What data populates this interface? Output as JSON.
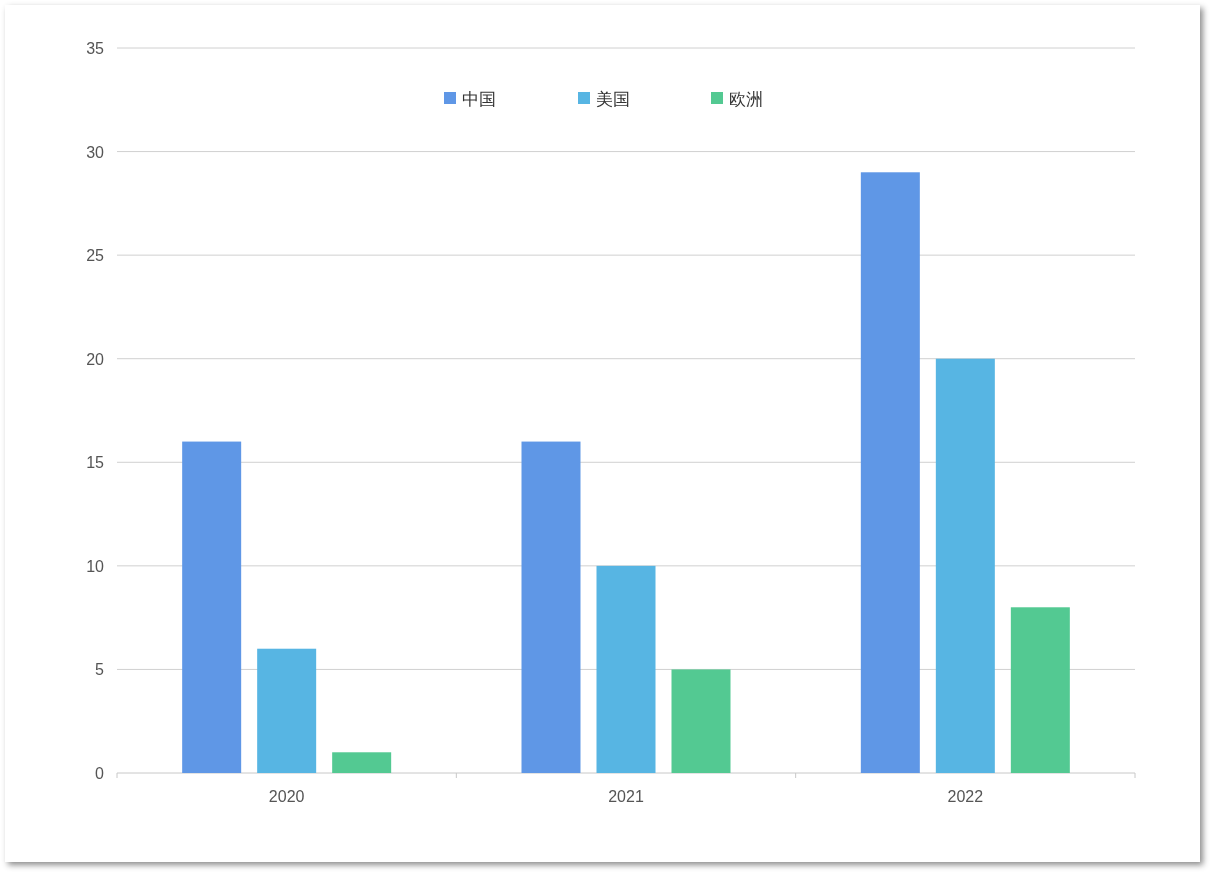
{
  "chart_data": {
    "type": "bar",
    "categories": [
      "2020",
      "2021",
      "2022"
    ],
    "series": [
      {
        "name": "中国",
        "color": "#5f97e6",
        "values": [
          16,
          16,
          29
        ]
      },
      {
        "name": "美国",
        "color": "#57b5e3",
        "values": [
          6,
          10,
          20
        ]
      },
      {
        "name": "欧洲",
        "color": "#53c992",
        "values": [
          1,
          5,
          8
        ]
      }
    ],
    "grid": true,
    "legend": true,
    "ylim": [
      0,
      35
    ],
    "yticks": [
      0,
      5,
      10,
      15,
      20,
      25,
      30,
      35
    ]
  }
}
